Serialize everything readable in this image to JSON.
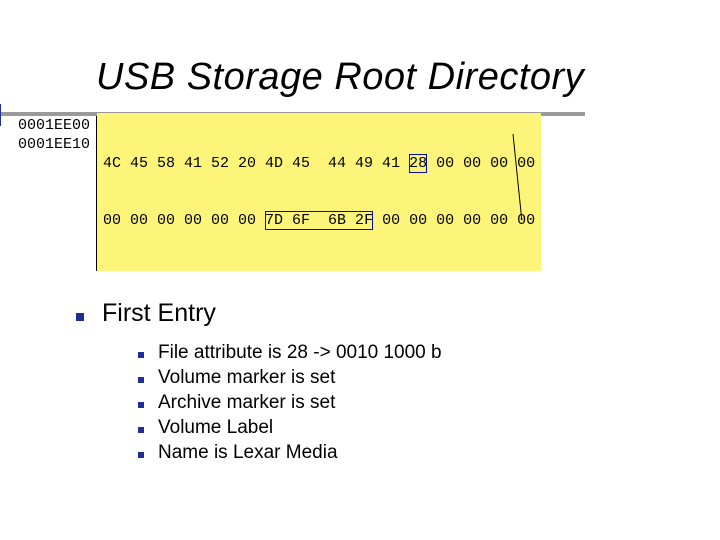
{
  "title": "USB Storage Root Directory",
  "hex": {
    "addresses": [
      "0001EE00",
      "0001EE10"
    ],
    "row1_before": "4C 45 58 41 52 20 4D 45  44 49 41 ",
    "row1_box": "28",
    "row1_after": " 00 00 00 00",
    "row2_before": "00 00 00 00 00 00 ",
    "row2_box": "7D 6F  6B 2F",
    "row2_after": " 00 00 00 00 00 00"
  },
  "list": {
    "heading": "First Entry",
    "items": [
      "File attribute is 28 -> 0010 1000 b",
      "Volume marker is set",
      "Archive marker is set",
      "Volume Label",
      "Name is Lexar Media"
    ]
  }
}
